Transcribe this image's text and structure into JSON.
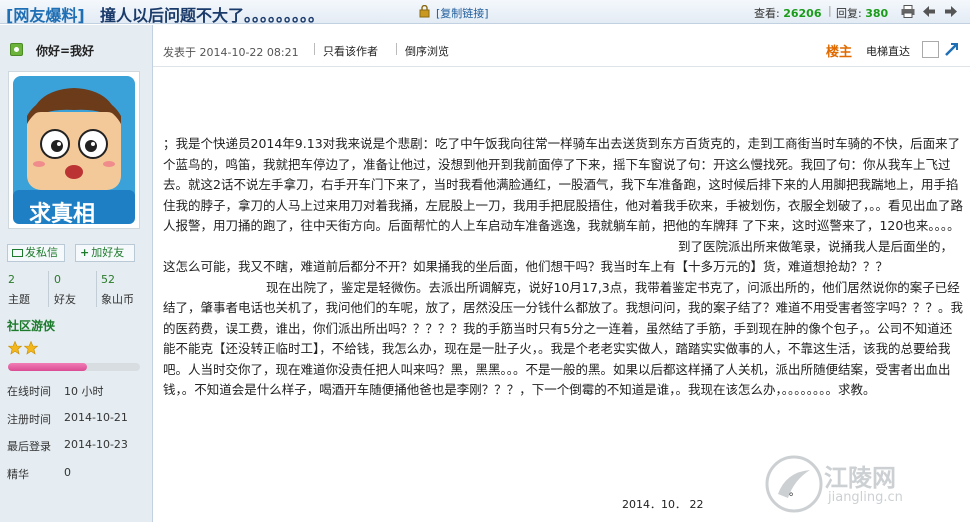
{
  "title": {
    "category": "[网友爆料]",
    "subject": "撞人以后问题不大了。。。。。。。。。",
    "copy_link": "[复制链接]",
    "view_label": "查看:",
    "view_count": "26206",
    "reply_label": "回复:",
    "reply_count": "380",
    "separator": "|"
  },
  "user": {
    "name": "你好=我好",
    "avatar_text": "求真相",
    "send_msg": "发私信",
    "add_friend": "加好友",
    "stats": [
      {
        "num": "2",
        "label": "主题"
      },
      {
        "num": "0",
        "label": "好友"
      },
      {
        "num": "52",
        "label": "象山币"
      }
    ],
    "group": "社区游侠",
    "progress": 0.6,
    "info": [
      {
        "label": "在线时间",
        "value": "10 小时"
      },
      {
        "label": "注册时间",
        "value": "2014-10-21"
      },
      {
        "label": "最后登录",
        "value": "2014-10-23"
      },
      {
        "label": "精华",
        "value": "0"
      }
    ]
  },
  "post": {
    "date": "发表于 2014-10-22 08:21",
    "author_only": "只看该作者",
    "reverse": "倒序浏览",
    "floor": "楼主",
    "jump": "电梯直达",
    "paragraphs": [
      "；我是个快递员2014年9.13对我来说是个悲剧：吃了中午饭我向往常一样骑车出去送货到东方百货克的，走到工商街当时车骑的不快，后面来了个蓝鸟的，鸣笛，我就把车停边了，准备让他过，没想到他开到我前面停了下来，摇下车窗说了句：开这么慢找死。我回了句：你从我车上飞过去。就这2话不说左手拿刀，右手开车门下来了，当时我看他满脸通红，一股酒气，我下车准备跑，这时候后排下来的人用脚把我踹地上，用手掐住我的脖子，拿刀的人马上过来用刀对着我捅，左屁股上一刀，我用手把屁股捂住，他对着我手砍来，手被划伤，衣服全划破了，。。看见出血了路人报警，用刀捅的跑了，往中天街方向。后面帮忙的人上车启动车准备逃逸，我就躺车前，把他的车牌拜 了下来，这时巡警来了，120也来。。。。",
      "到了医院派出所来做笔录，说捅我人是后面坐的，这怎么可能，我又不瞎，难道前后都分不开？如果捅我的坐后面，他们想干吗？我当时车上有【十多万元的】货，难道想抢劫？？？",
      "现在出院了，鉴定是轻微伤。去派出所调解克，说好10月17,3点，我带着鉴定书克了，问派出所的，他们居然说你的案子已经结了，肇事者电话也关机了，我问他们的车呢，放了，居然没压一分钱什么都放了。我想问问，我的案子结了？难道不用受害者签字吗？？？。我的医药费，误工费，谁出，你们派出所出吗？？？？？我的手筋当时只有5分之一连着，虽然结了手筋，手到现在肿的像个包子，。公司不知道还能不能克【还没转正临时工】，不给钱，我怎么办，现在是一肚子火，。我是个老老实实做人，踏踏实实做事的人，不靠这生活，该我的总要给我吧。人当时交你了，现在难道你没责任把人叫来吗？黑，黑黑。。。不是一般的黑。如果以后都这样捅了人关机，派出所随便结案，受害者出血出钱，。不知道会是什么样子，喝酒开车随便捅他爸也是李刚？？？，下一个倒霉的不知道是谁，。我现在该怎么办，。。。。。。。。求教。"
    ],
    "signature": "2014．10． 22",
    "trailing_dot": "。"
  },
  "watermark": {
    "name": "江陵网",
    "url": "jiangling.cn"
  }
}
